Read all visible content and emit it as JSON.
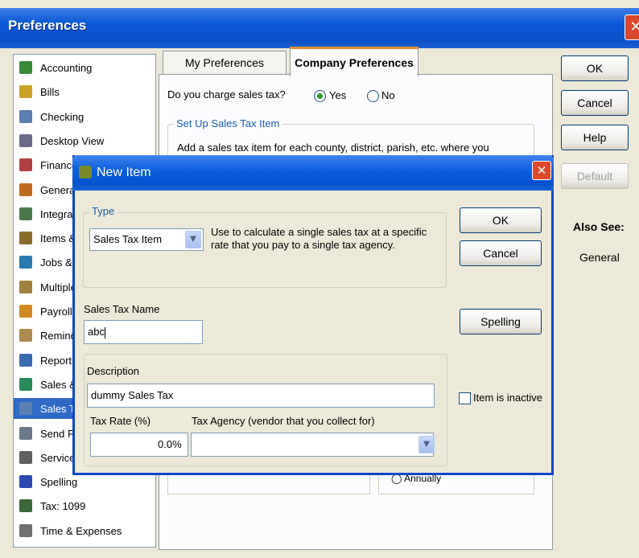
{
  "preferences": {
    "title": "Preferences",
    "categories": [
      {
        "label": "Accounting",
        "icon": "accounting-icon",
        "selected": false
      },
      {
        "label": "Bills",
        "icon": "bills-icon",
        "selected": false
      },
      {
        "label": "Checking",
        "icon": "checking-icon",
        "selected": false
      },
      {
        "label": "Desktop View",
        "icon": "desktop-view-icon",
        "selected": false
      },
      {
        "label": "Finance",
        "icon": "finance-charge-icon",
        "selected": false
      },
      {
        "label": "Genera",
        "icon": "general-icon",
        "selected": false
      },
      {
        "label": "Integra",
        "icon": "integrated-apps-icon",
        "selected": false
      },
      {
        "label": "Items &",
        "icon": "items-inventory-icon",
        "selected": false
      },
      {
        "label": "Jobs &",
        "icon": "jobs-estimates-icon",
        "selected": false
      },
      {
        "label": "Multiple",
        "icon": "multiple-currencies-icon",
        "selected": false
      },
      {
        "label": "Payroll",
        "icon": "payroll-icon",
        "selected": false
      },
      {
        "label": "Remind",
        "icon": "reminders-icon",
        "selected": false
      },
      {
        "label": "Report",
        "icon": "reports-icon",
        "selected": false
      },
      {
        "label": "Sales &",
        "icon": "sales-customers-icon",
        "selected": false
      },
      {
        "label": "Sales T",
        "icon": "sales-tax-icon",
        "selected": true
      },
      {
        "label": "Send F",
        "icon": "send-forms-icon",
        "selected": false
      },
      {
        "label": "Service",
        "icon": "service-connection-icon",
        "selected": false
      },
      {
        "label": "Spelling",
        "icon": "spelling-icon",
        "selected": false
      },
      {
        "label": "Tax: 1099",
        "icon": "tax-1099-icon",
        "selected": false
      },
      {
        "label": "Time & Expenses",
        "icon": "time-expenses-icon",
        "selected": false
      }
    ],
    "tabs": {
      "my": "My Preferences",
      "company": "Company Preferences"
    },
    "sales_tax_question": "Do you charge sales tax?",
    "yes_label": "Yes",
    "no_label": "No",
    "setup_title": "Set Up Sales Tax Item",
    "setup_text": "Add a sales tax item for each county, district, parish, etc. where you",
    "annually": "Annually",
    "buttons": {
      "ok": "OK",
      "cancel": "Cancel",
      "help": "Help",
      "default": "Default"
    },
    "also_see": "Also See:",
    "general": "General"
  },
  "new_item": {
    "title": "New Item",
    "type_label": "Type",
    "type_value": "Sales Tax Item",
    "type_description": "Use to calculate a single sales tax at a specific rate that you pay to a single tax agency.",
    "ok": "OK",
    "cancel": "Cancel",
    "spelling": "Spelling",
    "sales_tax_name_label": "Sales Tax Name",
    "sales_tax_name_value": "abc",
    "description_label": "Description",
    "description_value": "dummy Sales Tax",
    "tax_rate_label": "Tax Rate (%)",
    "tax_rate_value": "0.0%",
    "tax_agency_label": "Tax Agency (vendor that you collect for)",
    "tax_agency_value": "",
    "item_inactive_label": "Item is inactive"
  },
  "colors": {
    "title_bar": "#0a58d6",
    "selection": "#316ac5",
    "close_button": "#d9482b"
  }
}
